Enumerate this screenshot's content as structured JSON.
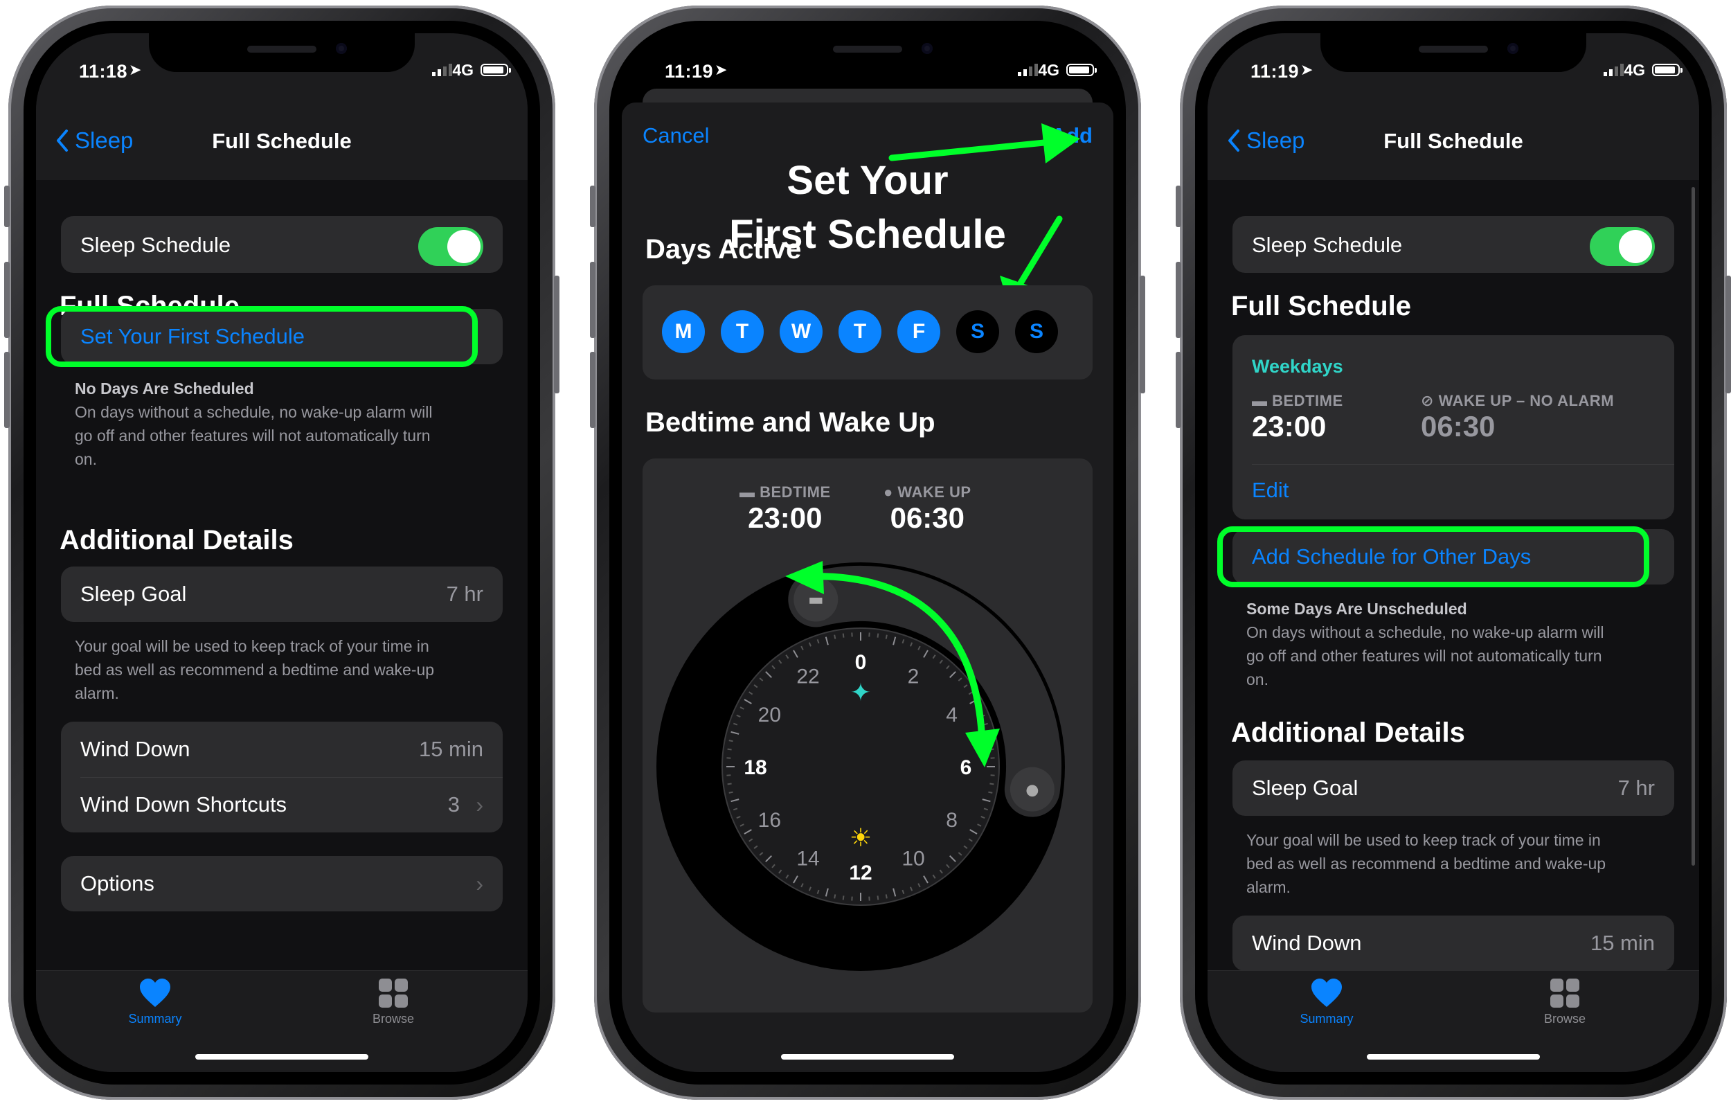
{
  "status": {
    "time1": "11:18",
    "time2": "11:19",
    "time3": "11:19",
    "network": "4G"
  },
  "phone1": {
    "back_label": "Sleep",
    "title": "Full Schedule",
    "sleep_schedule_label": "Sleep Schedule",
    "full_schedule_header": "Full Schedule",
    "set_first_schedule": "Set Your First Schedule",
    "no_days_title": "No Days Are Scheduled",
    "no_days_text_1": "On days without a schedule, no wake-up alarm will",
    "no_days_text_2": "go off and other features will not automatically turn",
    "no_days_text_3": "on.",
    "additional_header": "Additional Details",
    "sleep_goal_label": "Sleep Goal",
    "sleep_goal_value": "7 hr",
    "goal_text_1": "Your goal will be used to keep track of your time in",
    "goal_text_2": "bed as well as recommend a bedtime and wake-up",
    "goal_text_3": "alarm.",
    "wind_down_label": "Wind Down",
    "wind_down_value": "15 min",
    "shortcuts_label": "Wind Down Shortcuts",
    "shortcuts_value": "3",
    "options_label": "Options"
  },
  "tabs": {
    "summary": "Summary",
    "browse": "Browse"
  },
  "phone2": {
    "cancel": "Cancel",
    "add": "Add",
    "title_1": "Set Your",
    "title_2": "First Schedule",
    "days_header": "Days Active",
    "days": [
      "M",
      "T",
      "W",
      "T",
      "F",
      "S",
      "S"
    ],
    "bed_header": "Bedtime and Wake Up",
    "bedtime_label": "BEDTIME",
    "bedtime_value": "23:00",
    "wake_label": "WAKE UP",
    "wake_value": "06:30",
    "clock_numbers": [
      "0",
      "2",
      "4",
      "6",
      "8",
      "10",
      "12",
      "14",
      "16",
      "18",
      "20",
      "22"
    ]
  },
  "phone3": {
    "back_label": "Sleep",
    "title": "Full Schedule",
    "sleep_schedule_label": "Sleep Schedule",
    "full_schedule_header": "Full Schedule",
    "weekdays": "Weekdays",
    "bedtime_label": "BEDTIME",
    "bedtime_value": "23:00",
    "wake_label": "WAKE UP – NO ALARM",
    "wake_value": "06:30",
    "edit": "Edit",
    "add_other": "Add Schedule for Other Days",
    "unscheduled_title": "Some Days Are Unscheduled",
    "unscheduled_text_1": "On days without a schedule, no wake-up alarm will",
    "unscheduled_text_2": "go off and other features will not automatically turn",
    "unscheduled_text_3": "on.",
    "additional_header": "Additional Details",
    "sleep_goal_label": "Sleep Goal",
    "sleep_goal_value": "7 hr",
    "goal_text_1": "Your goal will be used to keep track of your time in",
    "goal_text_2": "bed as well as recommend a bedtime and wake-up",
    "goal_text_3": "alarm.",
    "wind_down_label": "Wind Down",
    "wind_down_value": "15 min"
  },
  "colors": {
    "accent": "#0a84ff",
    "toggle_on": "#30d158",
    "highlight": "#00ff2a",
    "teal": "#30d5c8"
  }
}
